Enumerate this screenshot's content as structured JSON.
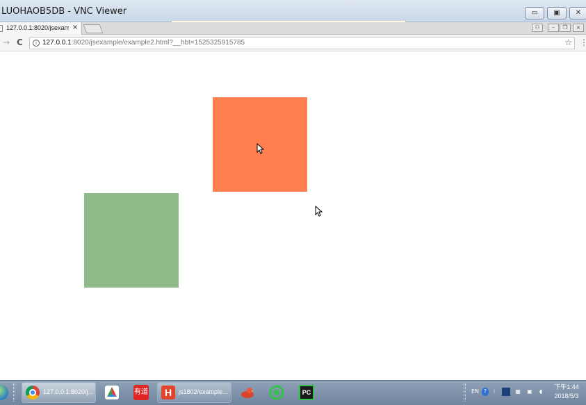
{
  "vnc": {
    "title": "LUOHAOB5DB - VNC Viewer",
    "controls": {
      "minimize": "▭",
      "restore": "▣",
      "close": "✕"
    }
  },
  "browser": {
    "tab": {
      "label": "127.0.0.1:8020/jsexamp",
      "close": "×"
    },
    "chrome_controls": {
      "user": "⚇",
      "minimize": "–",
      "restore": "❐",
      "close": "×"
    },
    "toolbar": {
      "back": "←",
      "forward": "→",
      "reload": "C",
      "menu": "⋮"
    },
    "address": {
      "host": "127.0.0.1",
      "rest": ":8020/jsexample/example2.html?__hbt=1525325915785",
      "info": "i",
      "star": "☆"
    }
  },
  "page": {
    "boxes": [
      {
        "name": "orange-box",
        "color": "#ff7f4f"
      },
      {
        "name": "green-box",
        "color": "#8fbb8a"
      }
    ]
  },
  "taskbar": {
    "tasks": [
      {
        "name": "task-chrome",
        "label": "127.0.0.1:8020/j...",
        "icon": "chrome-icon"
      },
      {
        "name": "task-hbuilder",
        "label": "js1802/example...",
        "icon": "hbuilder-icon",
        "icon_text": "H"
      }
    ],
    "pinned": [
      {
        "name": "pinned-app-a",
        "icon": "color-wheel-icon"
      },
      {
        "name": "pinned-youdao",
        "icon": "youdao-icon",
        "text": "有道"
      },
      {
        "name": "pinned-bird",
        "icon": "bird-icon"
      },
      {
        "name": "pinned-wechat",
        "icon": "wechat-icon"
      },
      {
        "name": "pinned-pycharm",
        "icon": "pycharm-icon",
        "text": "PC"
      }
    ],
    "tray": {
      "lang": "EN",
      "help": "?"
    },
    "clock": {
      "time": "下午1:44",
      "date": "2018/5/3"
    }
  }
}
